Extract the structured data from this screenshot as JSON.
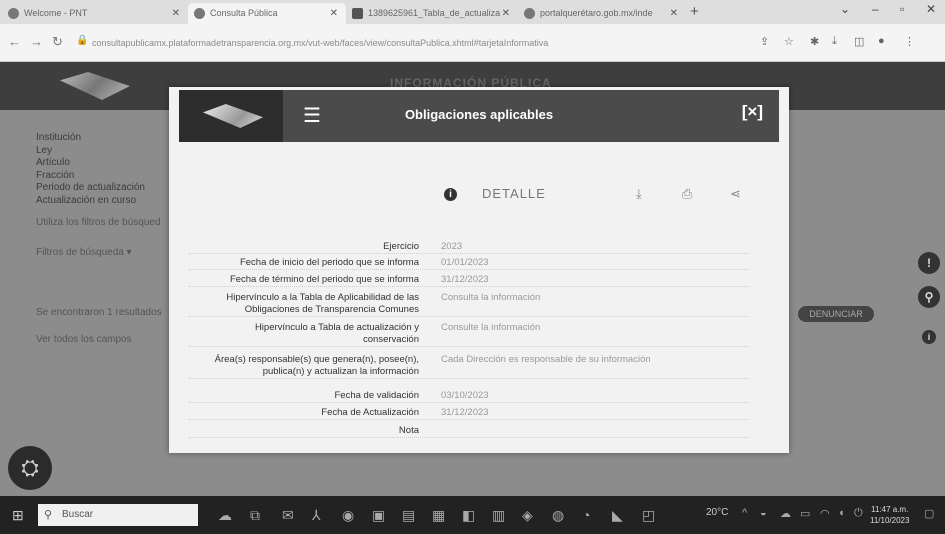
{
  "browser": {
    "tabs": [
      {
        "label": "Welcome - PNT",
        "active": false
      },
      {
        "label": "Consulta Pública",
        "active": true
      },
      {
        "label": "1389625961_Tabla_de_actualiza",
        "active": false
      },
      {
        "label": "portalquerétaro.gob.mx/inde",
        "active": false
      }
    ],
    "new_tab": "+",
    "url": "consultapublicamx.plataformadetransparencia.org.mx/vut-web/faces/view/consultaPublica.xhtml#tarjetaInformativa"
  },
  "page": {
    "header_title": "INFORMACIÓN PÚBLICA",
    "left_items": [
      "Institución",
      "Ley",
      "Artículo",
      "Fracción",
      "Periodo de actualización",
      "Actualización en curso"
    ],
    "filter_hint": "Utiliza los filtros de búsqued",
    "filters_toggle": "Filtros de búsqueda ▾",
    "results_text": "Se encontraron 1 resultados",
    "see_all": "Ver todos los campos",
    "denunciar": "DENUNCIAR",
    "accent": "#3e3e3e"
  },
  "modal": {
    "title": "Obligaciones aplicables",
    "close": "[×]",
    "detail_label": "DETALLE",
    "icons": [
      "info-icon",
      "download-icon",
      "print-icon",
      "share-icon"
    ],
    "rows": [
      {
        "label": "Ejercicio",
        "value": "2023"
      },
      {
        "label": "Fecha de inicio del periodo que se informa",
        "value": "01/01/2023"
      },
      {
        "label": "Fecha de término del periodo que se informa",
        "value": "31/12/2023"
      },
      {
        "label": "Hipervínculo a la Tabla de Aplicabilidad de las Obligaciones de Transparencia Comunes",
        "value": "Consulta la información"
      },
      {
        "label": "Hipervínculo a Tabla de actualización y conservación",
        "value": "Consulte la información"
      },
      {
        "label": "Área(s) responsable(s) que genera(n), posee(n), publica(n) y actualizan la información",
        "value": "Cada Dirección es responsable de su información"
      },
      {
        "label": "Fecha de validación",
        "value": "03/10/2023"
      },
      {
        "label": "Fecha de Actualización",
        "value": "31/12/2023"
      },
      {
        "label": "Nota",
        "value": ""
      }
    ]
  },
  "taskbar": {
    "search_placeholder": "Buscar",
    "weather": "20°C",
    "time": "11:47 a.m.",
    "date": "11/10/2023"
  }
}
